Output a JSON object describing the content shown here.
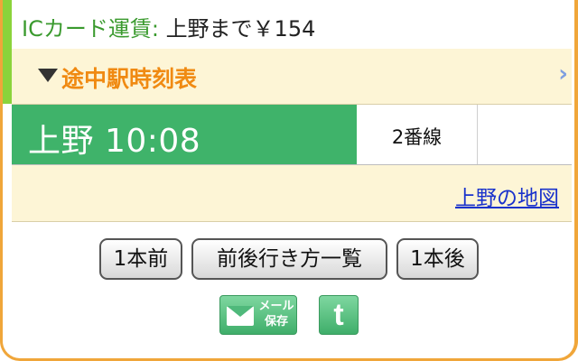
{
  "fare": {
    "label": "ICカード運賃:",
    "value": "上野まで￥154"
  },
  "timetable": {
    "label": "途中駅時刻表"
  },
  "departure": {
    "station_time": "上野 10:08",
    "platform": "2番線"
  },
  "map": {
    "link": "上野の地図"
  },
  "navigation": {
    "prev": "1本前",
    "list": "前後行き方一覧",
    "next": "1本後"
  },
  "share": {
    "mail_line1": "メール",
    "mail_line2": "保存",
    "twitter_glyph": "t"
  },
  "icons": {
    "expand": "triangle-down-icon",
    "chevron": "chevron-right-icon",
    "mail": "mail-envelope-icon",
    "twitter": "twitter-icon"
  },
  "colors": {
    "border": "#f0a63a",
    "accent_green": "#3fb36a",
    "timetable_orange": "#f08a12",
    "link_blue": "#1a33cc",
    "cream": "#fdf5d6"
  }
}
